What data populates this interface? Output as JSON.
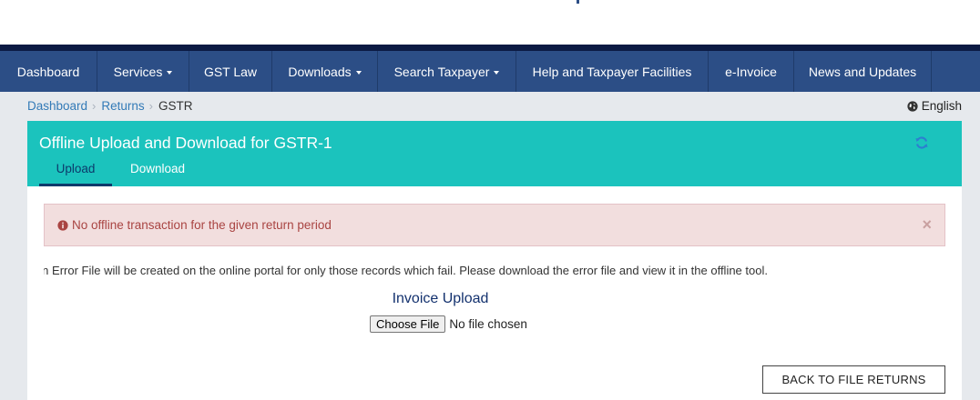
{
  "nav": {
    "items": [
      {
        "label": "Dashboard",
        "dropdown": false
      },
      {
        "label": "Services",
        "dropdown": true
      },
      {
        "label": "GST Law",
        "dropdown": false
      },
      {
        "label": "Downloads",
        "dropdown": true
      },
      {
        "label": "Search Taxpayer",
        "dropdown": true
      },
      {
        "label": "Help and Taxpayer Facilities",
        "dropdown": false
      },
      {
        "label": "e-Invoice",
        "dropdown": false
      },
      {
        "label": "News and Updates",
        "dropdown": false
      }
    ]
  },
  "breadcrumb": {
    "items": [
      "Dashboard",
      "Returns",
      "GSTR"
    ]
  },
  "language": {
    "label": "English",
    "icon": "globe-icon"
  },
  "card": {
    "title": "Offline Upload and Download for GSTR-1",
    "refresh_icon": "refresh-icon",
    "tabs": [
      {
        "label": "Upload",
        "active": true
      },
      {
        "label": "Download",
        "active": false
      }
    ]
  },
  "alert": {
    "message": "No offline transaction for the given return period",
    "icon": "info-circle-icon",
    "close": "×"
  },
  "validation_text": "If any of the data (invoice or other record) fails validation, an Error File will be created on the online portal for only those records which fail. Please download the error file and view it in the offline tool.",
  "upload": {
    "label": "Invoice Upload",
    "choose_button": "Choose File",
    "file_status": "No file chosen"
  },
  "back_button": "BACK TO FILE RETURNS",
  "colors": {
    "nav_bg": "#2c4e86",
    "header_bg": "#1bc3bd",
    "alert_bg": "#f2dede",
    "alert_text": "#a94442",
    "link": "#337ab7"
  }
}
